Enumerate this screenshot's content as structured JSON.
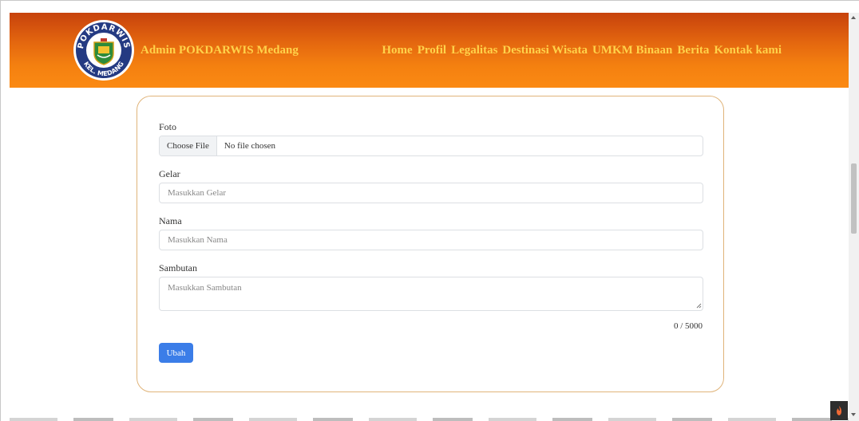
{
  "header": {
    "brand": "Admin POKDARWIS Medang",
    "logo_top_text": "POKDARWIS",
    "logo_bottom_text": "KEL. MEDANG",
    "nav": [
      "Home",
      "Profil",
      "Legalitas",
      "Destinasi Wisata",
      "UMKM Binaan",
      "Berita",
      "Kontak kami"
    ],
    "text_color": "#ffd24a",
    "gradient_start": "#c7420c",
    "gradient_end": "#fb8a13"
  },
  "form": {
    "foto_label": "Foto",
    "file_button": "Choose File",
    "file_status": "No file chosen",
    "gelar_label": "Gelar",
    "gelar_placeholder": "Masukkan Gelar",
    "gelar_value": "",
    "nama_label": "Nama",
    "nama_placeholder": "Masukkan Nama",
    "nama_value": "",
    "sambutan_label": "Sambutan",
    "sambutan_placeholder": "Masukkan Sambutan",
    "sambutan_value": "",
    "counter": "0 / 5000",
    "submit_label": "Ubah",
    "accent_color": "#3b7de8",
    "card_border_color": "#e0b47a"
  },
  "icons": {
    "logo": "pokdarwis-emblem",
    "debug": "flame-icon",
    "resize": "resize-grip-icon"
  }
}
